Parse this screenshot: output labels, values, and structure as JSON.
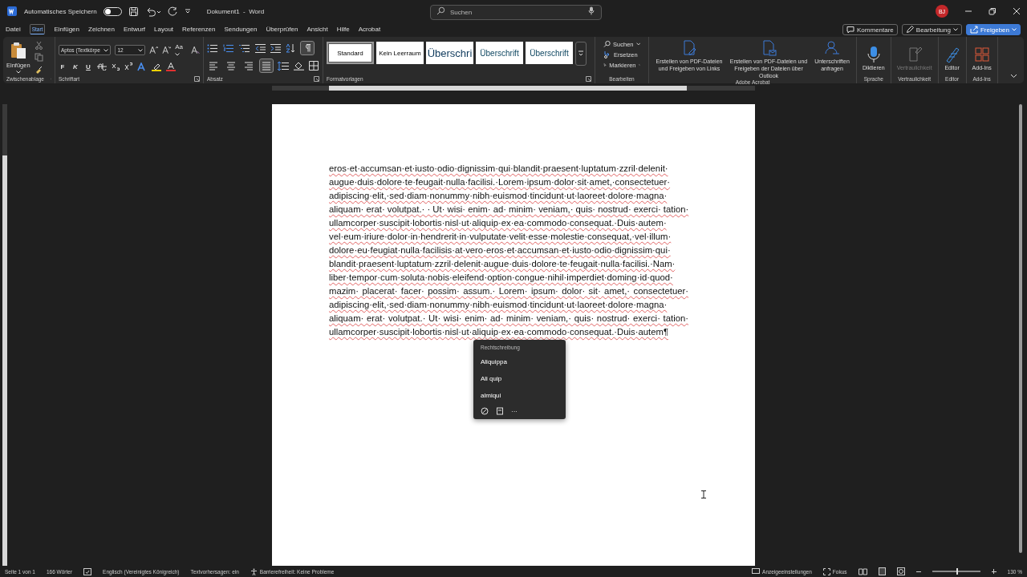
{
  "title_bar": {
    "autosave_label": "Automatisches Speichern",
    "autosave_on": false,
    "doc_title": "Dokument1  -  Word",
    "search_placeholder": "Suchen",
    "avatar": "BJ"
  },
  "menu_tabs": [
    {
      "label": "Datei",
      "selected": false
    },
    {
      "label": "Start",
      "selected": true
    },
    {
      "label": "Einfügen",
      "selected": false
    },
    {
      "label": "Zeichnen",
      "selected": false
    },
    {
      "label": "Entwurf",
      "selected": false
    },
    {
      "label": "Layout",
      "selected": false
    },
    {
      "label": "Referenzen",
      "selected": false
    },
    {
      "label": "Sendungen",
      "selected": false
    },
    {
      "label": "Überprüfen",
      "selected": false
    },
    {
      "label": "Ansicht",
      "selected": false
    },
    {
      "label": "Hilfe",
      "selected": false
    },
    {
      "label": "Acrobat",
      "selected": false
    }
  ],
  "actions": {
    "comments": "Kommentare",
    "editing": "Bearbeitung",
    "share": "Freigeben"
  },
  "ribbon": {
    "clipboard": {
      "paste": "Einfügen",
      "label": "Zwischenablage"
    },
    "font": {
      "font_name": "Aptos (Textkörpe",
      "font_size": "12",
      "format_letters": [
        "F",
        "K",
        "U"
      ],
      "case_label": "Aa",
      "label": "Schriftart"
    },
    "paragraph": {
      "marks_on": true,
      "align_buttons": [
        {
          "selected": false
        },
        {
          "selected": false
        },
        {
          "selected": false
        },
        {
          "selected": true
        }
      ],
      "label": "Absatz"
    },
    "styles": {
      "items": [
        {
          "label": "Standard",
          "selected": true,
          "kind": "normal"
        },
        {
          "label": "Kein Leerraum",
          "selected": false,
          "kind": "normal"
        },
        {
          "label": "Überschri",
          "selected": false,
          "kind": "heading1"
        },
        {
          "label": "Überschrift",
          "selected": false,
          "kind": "heading2"
        },
        {
          "label": "Überschrift",
          "selected": false,
          "kind": "heading2"
        }
      ],
      "label": "Formatvorlagen"
    },
    "editing": {
      "find": "Suchen",
      "replace": "Ersetzen",
      "select": "Markieren",
      "label": "Bearbeiten"
    },
    "acrobat": {
      "buttons": [
        {
          "label": "Erstellen von PDF-Dateien und Freigeben von Links",
          "kind": "pdf-link"
        },
        {
          "label": "Erstellen von PDF-Dateien und Freigeben der Dateien über Outlook",
          "kind": "pdf-mail"
        },
        {
          "label": "Unterschriften anfragen",
          "kind": "sign"
        }
      ],
      "label": "Adobe Acrobat"
    },
    "extras": [
      {
        "button": "Diktieren",
        "label": "Sprache",
        "kind": "mic",
        "disabled": false
      },
      {
        "button": "Vertraulichkeit",
        "label": "Vertraulichkeit",
        "kind": "sensitivity",
        "disabled": true
      },
      {
        "button": "Editor",
        "label": "Editor",
        "kind": "editor",
        "disabled": false
      },
      {
        "button": "Add-Ins",
        "label": "Add-Ins",
        "kind": "addins",
        "disabled": false
      }
    ]
  },
  "document": {
    "lines": [
      "eros·et·accumsan·et·iusto·odio·dignissim·qui·blandit·praesent·luptatum·zzril·delenit·",
      "augue·duis·dolore·te·feugait·nulla·facilisi.·Lorem·ipsum·dolor·sit·amet,·consectetuer·",
      "adipiscing·elit,·sed·diam·nonummy·nibh·euismod·tincidunt·ut·laoreet·dolore·magna·",
      "aliquam· erat· volutpat.· · Ut· wisi· enim· ad· minim· veniam,· quis· nostrud· exerci· tation·",
      "ullamcorper·suscipit·lobortis·nisl·ut·aliquip·ex·ea·commodo·consequat.·Duis·autem·",
      "vel·eum·iriure·dolor·in·hendrerit·in·vulputate·velit·esse·molestie·consequat,·vel·illum·",
      "dolore·eu·feugiat·nulla·facilisis·at·vero·eros·et·accumsan·et·iusto·odio·dignissim·qui·",
      "blandit·praesent·luptatum·zzril·delenit·augue·duis·dolore·te·feugait·nulla·facilisi.·Nam·",
      "liber·tempor·cum·soluta·nobis·eleifend·option·congue·nihil·imperdiet·doming·id·quod·",
      "mazim· placerat· facer· possim· assum.· Lorem· ipsum· dolor· sit· amet,· consectetuer·",
      "adipiscing·elit,·sed·diam·nonummy·nibh·euismod·tincidunt·ut·laoreet·dolore·magna·",
      "aliquam· erat· volutpat.· Ut· wisi· enim· ad· minim· veniam,· quis· nostrud· exerci· tation·",
      "ullamcorper·suscipit·lobortis·nisl·ut·aliquip·ex·ea·commodo·consequat.·Duis·autem¶"
    ]
  },
  "spelling_menu": {
    "header": "Rechtschreibung",
    "suggestions": [
      "Aliquippa",
      "Ali quip",
      "almiqui"
    ],
    "more": "···"
  },
  "status_bar": {
    "page": "Seite 1 von 1",
    "words": "166 Wörter",
    "language": "Englisch (Vereinigtes Königreich)",
    "predictions": "Textvorhersagen: ein",
    "accessibility": "Barrierefreiheit: Keine Probleme",
    "display_settings": "Anzeigeeinstellungen",
    "focus": "Fokus",
    "zoom_slider": {
      "level": 0.5
    },
    "zoom": "130 %"
  }
}
